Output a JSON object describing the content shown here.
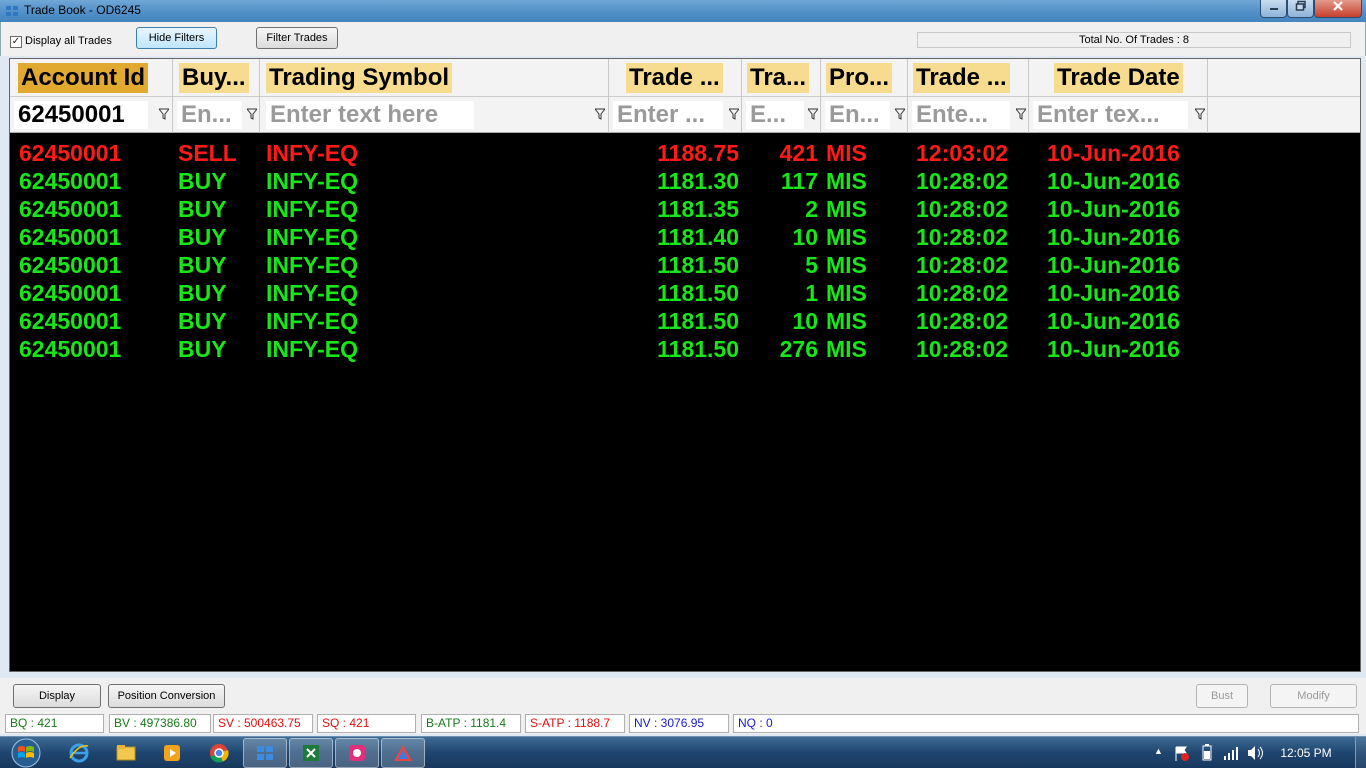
{
  "window": {
    "title": "Trade Book - OD6245",
    "min": "0",
    "max": "1",
    "close": "r"
  },
  "toolbar": {
    "display_all_checked": "✓",
    "display_all_label": "Display all Trades",
    "hide_filters": "Hide Filters",
    "filter_trades": "Filter Trades",
    "total_trades": "Total No. Of Trades : 8"
  },
  "columns": [
    {
      "key": "account",
      "header": "Account Id",
      "filter": "62450001",
      "filter_has_value": true
    },
    {
      "key": "buysell",
      "header": "Buy...",
      "filter": "En...",
      "filter_has_value": false
    },
    {
      "key": "symbol",
      "header": "Trading Symbol",
      "filter": "Enter text here",
      "filter_has_value": false
    },
    {
      "key": "price",
      "header": "Trade ...",
      "filter": "Enter ...",
      "filter_has_value": false
    },
    {
      "key": "qty",
      "header": "Tra...",
      "filter": "E...",
      "filter_has_value": false
    },
    {
      "key": "product",
      "header": "Pro...",
      "filter": "En...",
      "filter_has_value": false
    },
    {
      "key": "time",
      "header": "Trade ...",
      "filter": "Ente...",
      "filter_has_value": false
    },
    {
      "key": "date",
      "header": "Trade Date",
      "filter": "Enter tex...",
      "filter_has_value": false
    }
  ],
  "trades": [
    {
      "side_class": "sell",
      "account": "62450001",
      "buysell": "SELL",
      "symbol": "INFY-EQ",
      "price": "1188.75",
      "qty": "421",
      "product": "MIS",
      "time": "12:03:02",
      "date": "10-Jun-2016"
    },
    {
      "side_class": "buy",
      "account": "62450001",
      "buysell": "BUY",
      "symbol": "INFY-EQ",
      "price": "1181.30",
      "qty": "117",
      "product": "MIS",
      "time": "10:28:02",
      "date": "10-Jun-2016"
    },
    {
      "side_class": "buy",
      "account": "62450001",
      "buysell": "BUY",
      "symbol": "INFY-EQ",
      "price": "1181.35",
      "qty": "2",
      "product": "MIS",
      "time": "10:28:02",
      "date": "10-Jun-2016"
    },
    {
      "side_class": "buy",
      "account": "62450001",
      "buysell": "BUY",
      "symbol": "INFY-EQ",
      "price": "1181.40",
      "qty": "10",
      "product": "MIS",
      "time": "10:28:02",
      "date": "10-Jun-2016"
    },
    {
      "side_class": "buy",
      "account": "62450001",
      "buysell": "BUY",
      "symbol": "INFY-EQ",
      "price": "1181.50",
      "qty": "5",
      "product": "MIS",
      "time": "10:28:02",
      "date": "10-Jun-2016"
    },
    {
      "side_class": "buy",
      "account": "62450001",
      "buysell": "BUY",
      "symbol": "INFY-EQ",
      "price": "1181.50",
      "qty": "1",
      "product": "MIS",
      "time": "10:28:02",
      "date": "10-Jun-2016"
    },
    {
      "side_class": "buy",
      "account": "62450001",
      "buysell": "BUY",
      "symbol": "INFY-EQ",
      "price": "1181.50",
      "qty": "10",
      "product": "MIS",
      "time": "10:28:02",
      "date": "10-Jun-2016"
    },
    {
      "side_class": "buy",
      "account": "62450001",
      "buysell": "BUY",
      "symbol": "INFY-EQ",
      "price": "1181.50",
      "qty": "276",
      "product": "MIS",
      "time": "10:28:02",
      "date": "10-Jun-2016"
    }
  ],
  "buttons": {
    "display": "Display",
    "position_conversion": "Position Conversion",
    "bust": "Bust",
    "modify": "Modify"
  },
  "status": [
    {
      "text": "BQ : 421",
      "color": "#1a7a1a"
    },
    {
      "text": "BV : 497386.80",
      "color": "#1a7a1a"
    },
    {
      "text": "SV : 500463.75",
      "color": "#e01010"
    },
    {
      "text": "SQ : 421",
      "color": "#e01010"
    },
    {
      "text": "B-ATP : 1181.4",
      "color": "#1a7a1a"
    },
    {
      "text": "S-ATP : 1188.7",
      "color": "#e01010"
    },
    {
      "text": "NV : 3076.95",
      "color": "#1a1ad0"
    },
    {
      "text": "NQ : 0",
      "color": "#1a1ad0"
    }
  ],
  "taskbar": {
    "clock": "12:05 PM",
    "tray_up": "▲"
  },
  "colors": {
    "sell": "#ff1a1a",
    "buy": "#19e619",
    "header_highlight": "#f7dc8f",
    "sorted_header": "#e2a931"
  }
}
